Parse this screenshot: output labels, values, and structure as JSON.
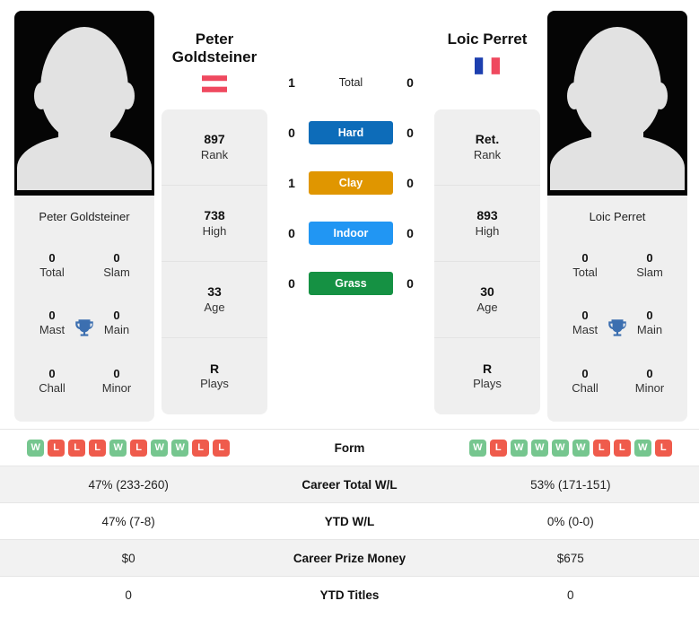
{
  "left_player": {
    "name_big": "Peter\nGoldsteiner",
    "name_line1": "Peter",
    "name_line2": "Goldsteiner",
    "name_small": "Peter Goldsteiner",
    "flag": "austria-flag",
    "stats": [
      {
        "value": "897",
        "label": "Rank"
      },
      {
        "value": "738",
        "label": "High"
      },
      {
        "value": "33",
        "label": "Age"
      },
      {
        "value": "R",
        "label": "Plays"
      }
    ],
    "titles": [
      {
        "value": "0",
        "label": "Total"
      },
      {
        "value": "0",
        "label": "Slam"
      },
      {
        "value": "0",
        "label": "Mast"
      },
      {
        "value": "0",
        "label": "Main"
      },
      {
        "value": "0",
        "label": "Chall"
      },
      {
        "value": "0",
        "label": "Minor"
      }
    ],
    "form": [
      "W",
      "L",
      "L",
      "L",
      "W",
      "L",
      "W",
      "W",
      "L",
      "L"
    ]
  },
  "right_player": {
    "name_big": "Loic Perret",
    "name_line1": "Loic Perret",
    "name_line2": "",
    "name_small": "Loic Perret",
    "flag": "france-flag",
    "stats": [
      {
        "value": "Ret.",
        "label": "Rank"
      },
      {
        "value": "893",
        "label": "High"
      },
      {
        "value": "30",
        "label": "Age"
      },
      {
        "value": "R",
        "label": "Plays"
      }
    ],
    "titles": [
      {
        "value": "0",
        "label": "Total"
      },
      {
        "value": "0",
        "label": "Slam"
      },
      {
        "value": "0",
        "label": "Mast"
      },
      {
        "value": "0",
        "label": "Main"
      },
      {
        "value": "0",
        "label": "Chall"
      },
      {
        "value": "0",
        "label": "Minor"
      }
    ],
    "form": [
      "W",
      "L",
      "W",
      "W",
      "W",
      "W",
      "L",
      "L",
      "W",
      "L"
    ]
  },
  "head_to_head": [
    {
      "label": "Total",
      "left": "1",
      "right": "0",
      "color": "",
      "style": "plain"
    },
    {
      "label": "Hard",
      "left": "0",
      "right": "0",
      "color": "#0D6CB9",
      "style": "pill"
    },
    {
      "label": "Clay",
      "left": "1",
      "right": "0",
      "color": "#E09600",
      "style": "pill"
    },
    {
      "label": "Indoor",
      "left": "0",
      "right": "0",
      "color": "#2196F3",
      "style": "pill"
    },
    {
      "label": "Grass",
      "left": "0",
      "right": "0",
      "color": "#159143",
      "style": "pill"
    }
  ],
  "comparison_rows": [
    {
      "label": "Form",
      "left": "",
      "right": "",
      "type": "form"
    },
    {
      "label": "Career Total W/L",
      "left": "47% (233-260)",
      "right": "53% (171-151)",
      "type": "text"
    },
    {
      "label": "YTD W/L",
      "left": "47% (7-8)",
      "right": "0% (0-0)",
      "type": "text"
    },
    {
      "label": "Career Prize Money",
      "left": "$0",
      "right": "$675",
      "type": "text"
    },
    {
      "label": "YTD Titles",
      "left": "0",
      "right": "0",
      "type": "text"
    }
  ],
  "colors": {
    "win_badge": "#76C68F",
    "loss_badge": "#EF5B4C",
    "trophy": "#3C6FB0",
    "card_bg": "#EFEFEF",
    "row_alt_bg": "#F2F2F2"
  },
  "icons": {
    "trophy": "trophy-icon",
    "austria_flag": "austria-flag-icon",
    "france_flag": "france-flag-icon",
    "avatar": "player-avatar-placeholder"
  }
}
